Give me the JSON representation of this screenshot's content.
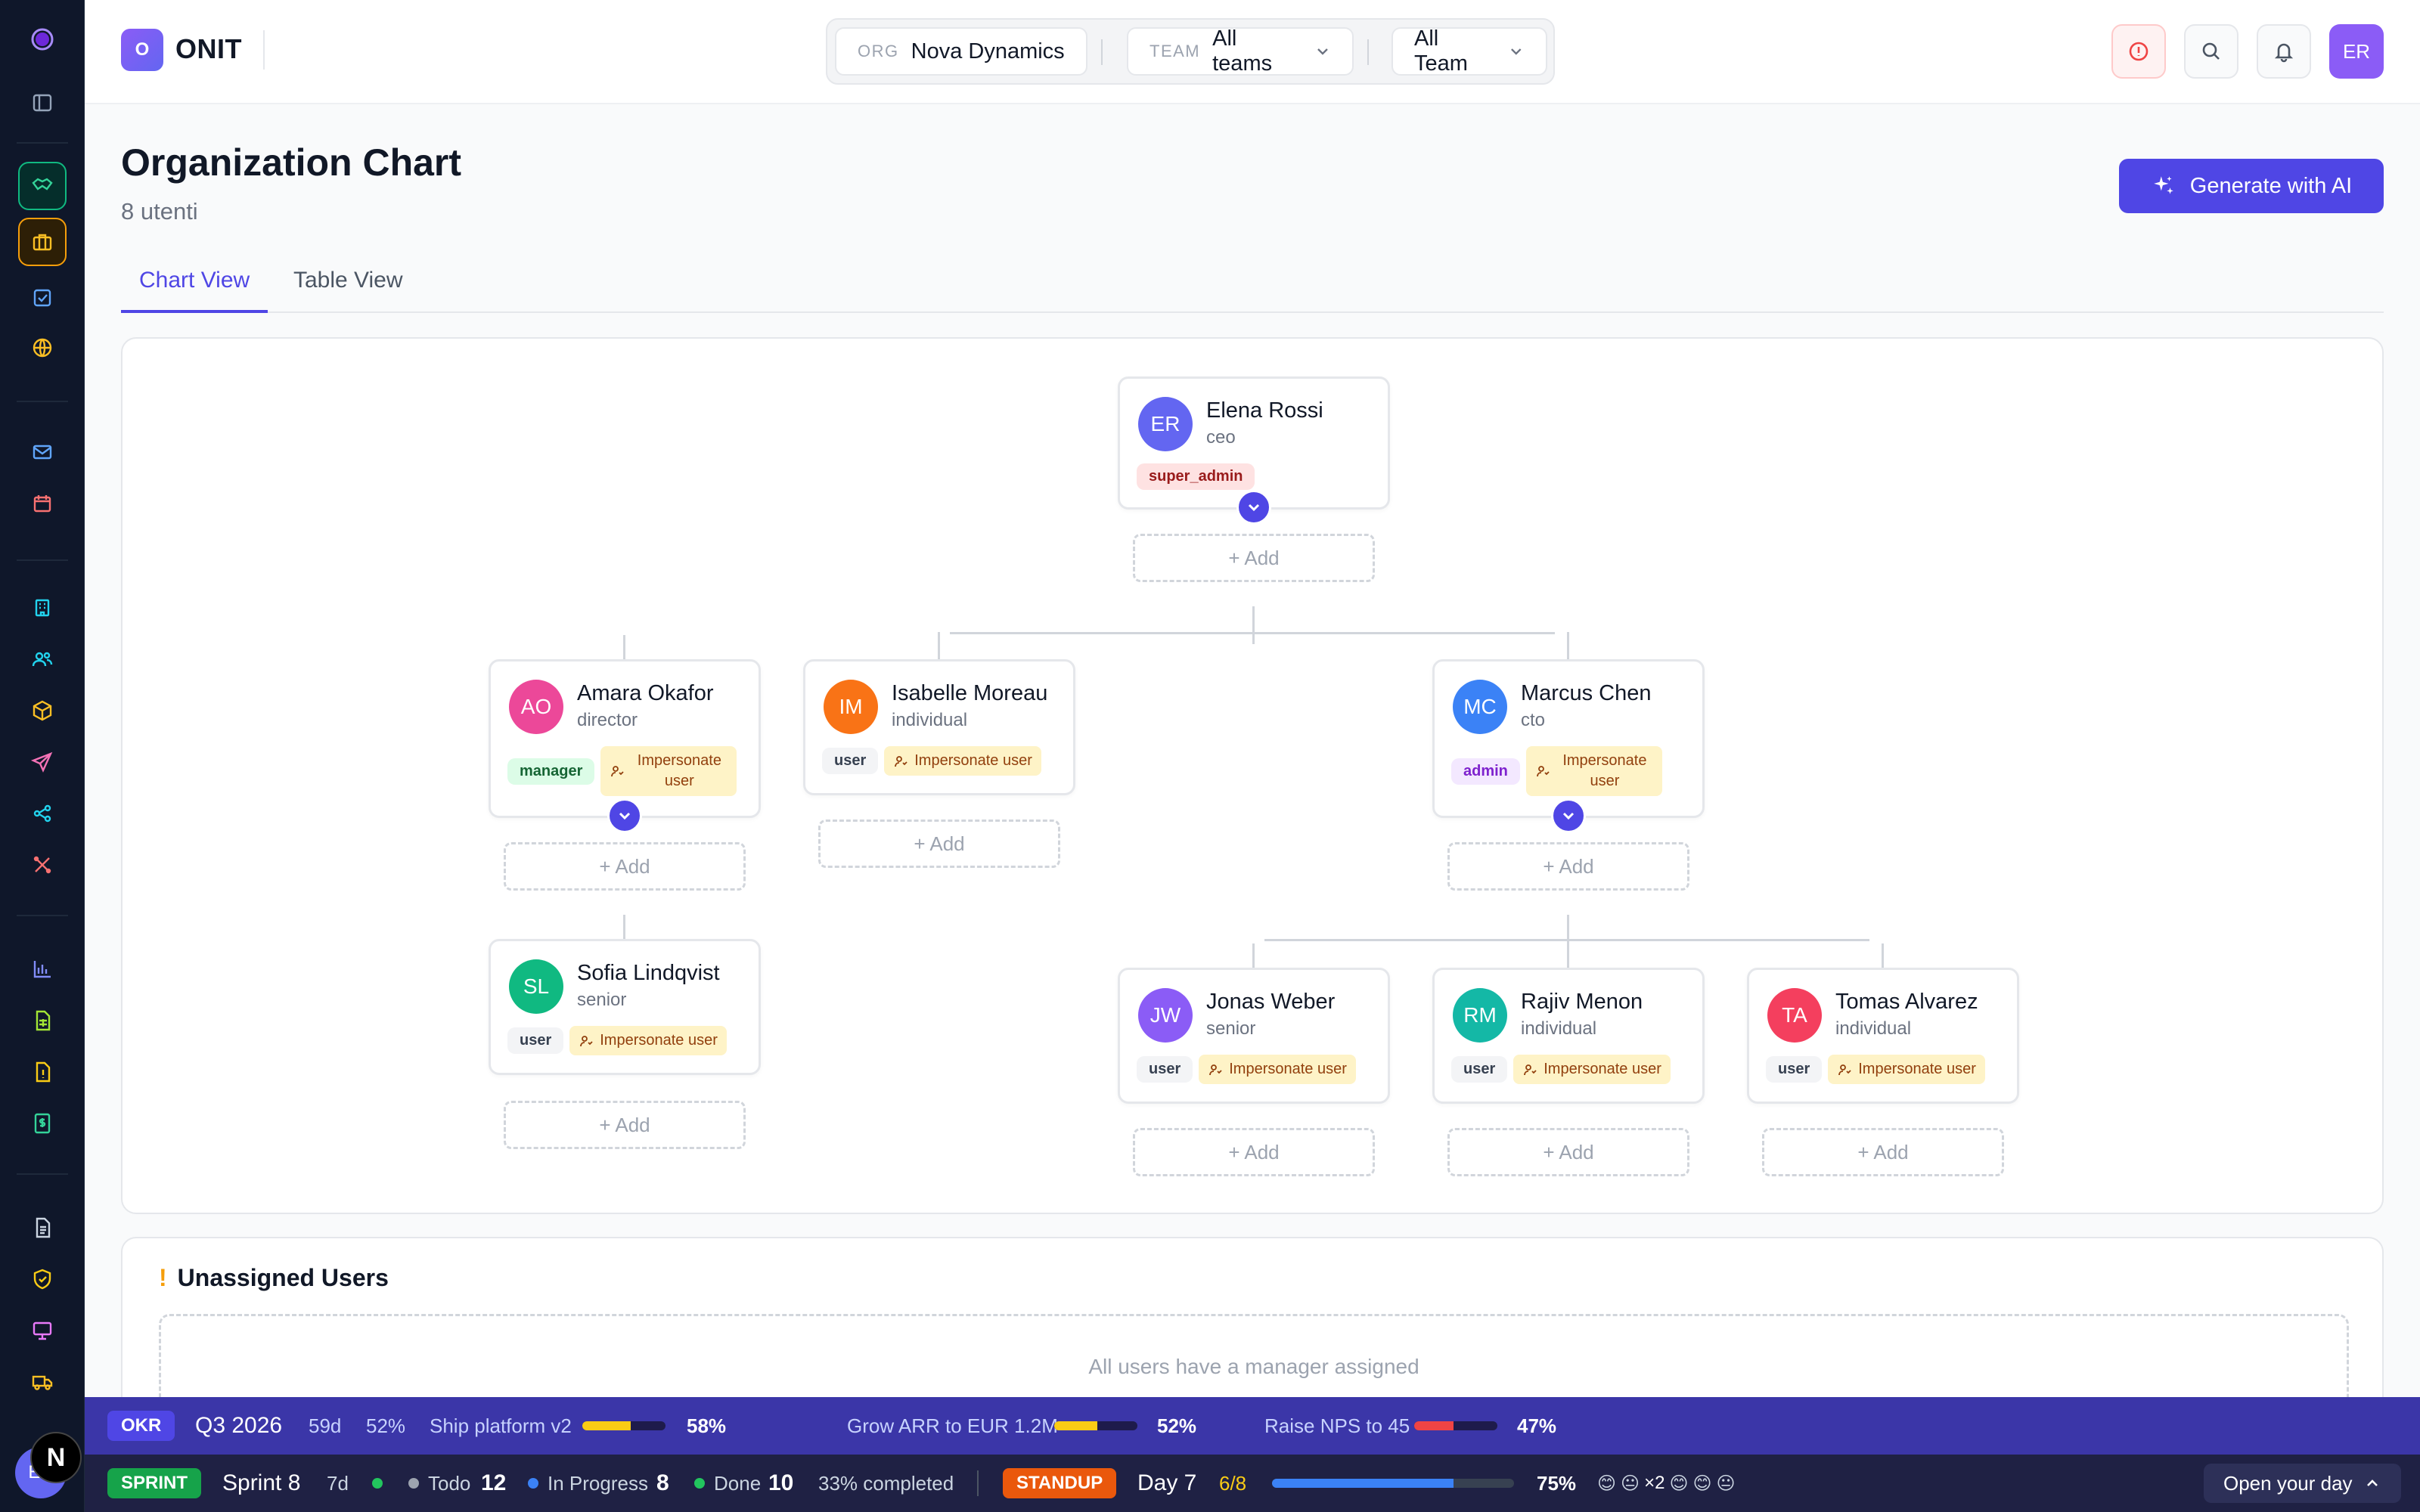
{
  "brand": {
    "logo_letter": "O",
    "name": "ONIT"
  },
  "filters": {
    "org_key": "ORG",
    "org_value": "Nova Dynamics",
    "team_key": "TEAM",
    "team_value": "All teams",
    "third_value": "All Team"
  },
  "user_initials": "ER",
  "page": {
    "title": "Organization Chart",
    "subtitle": "8 utenti",
    "generate_label": "Generate with AI"
  },
  "tabs": [
    {
      "label": "Chart View",
      "active": true
    },
    {
      "label": "Table View",
      "active": false
    }
  ],
  "add_label": "+ Add",
  "impersonate_label": "Impersonate user",
  "nodes": [
    {
      "initials": "ER",
      "name": "Elena Rossi",
      "role": "ceo",
      "badge": "super_admin",
      "color": "#6366f1"
    },
    {
      "initials": "AO",
      "name": "Amara Okafor",
      "role": "director",
      "badge": "manager",
      "color": "#ec4899"
    },
    {
      "initials": "IM",
      "name": "Isabelle Moreau",
      "role": "individual",
      "badge": "user",
      "color": "#f97316"
    },
    {
      "initials": "MC",
      "name": "Marcus Chen",
      "role": "cto",
      "badge": "admin",
      "color": "#3b82f6"
    },
    {
      "initials": "SL",
      "name": "Sofia Lindqvist",
      "role": "senior",
      "badge": "user",
      "color": "#10b981"
    },
    {
      "initials": "JW",
      "name": "Jonas Weber",
      "role": "senior",
      "badge": "user",
      "color": "#8b5cf6"
    },
    {
      "initials": "RM",
      "name": "Rajiv Menon",
      "role": "individual",
      "badge": "user",
      "color": "#14b8a6"
    },
    {
      "initials": "TA",
      "name": "Tomas Alvarez",
      "role": "individual",
      "badge": "user",
      "color": "#f43f5e"
    }
  ],
  "unassigned": {
    "title": "Unassigned Users",
    "empty": "All users have a manager assigned"
  },
  "okr": {
    "label": "OKR",
    "quarter": "Q3 2026",
    "days": "59d",
    "overall": "52%",
    "goals": [
      {
        "name": "Ship platform v2",
        "pct": "58%",
        "value": 0.58,
        "color": "#facc15"
      },
      {
        "name": "Grow ARR to EUR 1.2M",
        "pct": "52%",
        "value": 0.52,
        "color": "#facc15"
      },
      {
        "name": "Raise NPS to 45",
        "pct": "47%",
        "value": 0.47,
        "color": "#ef4444"
      }
    ]
  },
  "sprint": {
    "label": "SPRINT",
    "name": "Sprint 8",
    "days": "7d",
    "todo_label": "Todo",
    "todo": "12",
    "inprog_label": "In Progress",
    "inprog": "8",
    "done_label": "Done",
    "done": "10",
    "completed": "33% completed",
    "standup_label": "STANDUP",
    "standup_day": "Day 7",
    "standup_count": "6/8",
    "standup_pct": "75%",
    "standup_value": 0.75,
    "emoji_multi": "×2",
    "open_label": "Open your day"
  },
  "notification_badge": "N",
  "sidebar_avatar": "ER"
}
